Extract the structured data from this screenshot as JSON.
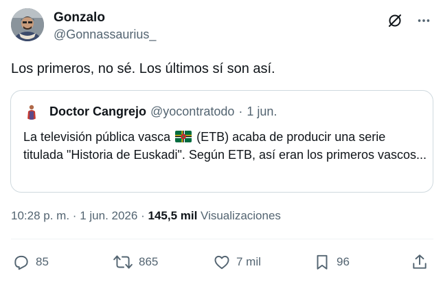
{
  "author": {
    "display_name": "Gonzalo",
    "handle": "@Gonnassaurius_",
    "avatar_icon": "user-avatar"
  },
  "header_actions": {
    "grok_icon": "grok-icon",
    "more_icon": "more-options-icon"
  },
  "tweet": {
    "text": "Los primeros, no sé. Los últimos sí son así."
  },
  "quote": {
    "display_name": "Doctor Cangrejo",
    "handle": "@yocontratodo",
    "separator": "·",
    "date": "1 jun.",
    "text_before_flag": "La televisión pública vasca",
    "flag_icon": "dominica-flag-emoji",
    "text_after_flag": "(ETB) acaba de producir una serie titulada \"Historia de Euskadi\". Según ETB, así eran los primeros vascos..."
  },
  "meta": {
    "time": "10:28 p. m.",
    "separator": "·",
    "date": "1 jun. 2026",
    "views_count": "145,5 mil",
    "views_label": "Visualizaciones"
  },
  "actions": {
    "replies": "85",
    "reposts": "865",
    "likes": "7 mil",
    "bookmarks": "96"
  },
  "colors": {
    "text_primary": "#0f1419",
    "text_secondary": "#536471",
    "border": "#cfd9de"
  }
}
